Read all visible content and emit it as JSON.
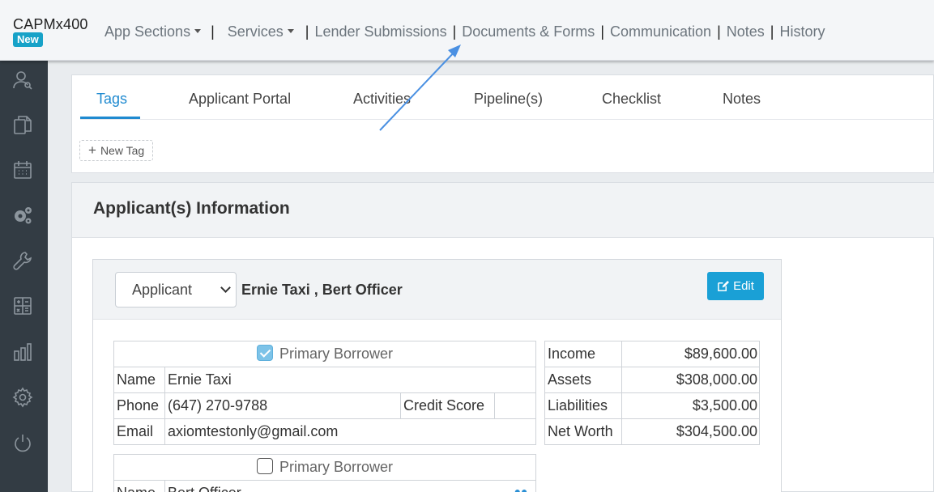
{
  "brand": {
    "name": "CAPMx400",
    "badge": "New"
  },
  "nav": {
    "app_sections": "App Sections",
    "services": "Services",
    "links": [
      "Lender Submissions",
      "Documents & Forms",
      "Communication",
      "Notes",
      "History"
    ]
  },
  "sidebar": {
    "icons": [
      "user-search-icon",
      "documents-icon",
      "calendar-icon",
      "gears-icon",
      "wrench-icon",
      "calculator-icon",
      "bar-chart-icon",
      "settings-icon",
      "power-icon"
    ]
  },
  "tabs": [
    "Tags",
    "Applicant Portal",
    "Activities",
    "Pipeline(s)",
    "Checklist",
    "Notes"
  ],
  "tags": {
    "new_tag": "New Tag"
  },
  "applicant_info": {
    "title": "Applicant(s) Information",
    "selector_value": "Applicant",
    "names": "Ernie Taxi , Bert Officer",
    "edit_label": "Edit",
    "borrower1": {
      "primary_label": "Primary Borrower",
      "primary_checked": true,
      "name_label": "Name",
      "name": "Ernie Taxi",
      "phone_label": "Phone",
      "phone": "(647) 270-9788",
      "credit_label": "Credit Score",
      "credit": "",
      "email_label": "Email",
      "email": "axiomtestonly@gmail.com"
    },
    "financials": [
      {
        "label": "Income",
        "value": "$89,600.00"
      },
      {
        "label": "Assets",
        "value": "$308,000.00"
      },
      {
        "label": "Liabilities",
        "value": "$3,500.00"
      },
      {
        "label": "Net Worth",
        "value": "$304,500.00"
      }
    ],
    "borrower2": {
      "primary_label": "Primary Borrower",
      "primary_checked": false,
      "name_label": "Name",
      "name": "Bert Officer"
    }
  },
  "colors": {
    "accent": "#1f8ad0",
    "edit_button": "#1aa0d6",
    "sidebar": "#333c44",
    "arrow": "#4a90e2"
  }
}
